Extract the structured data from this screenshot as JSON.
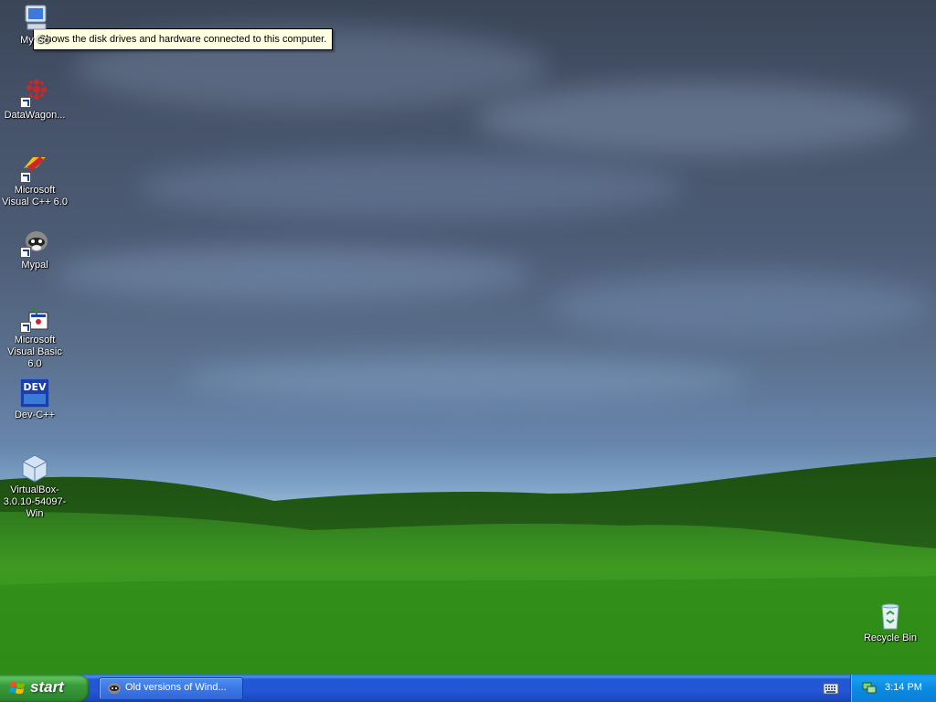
{
  "tooltip": {
    "text": "Shows the disk drives and hardware connected to this computer."
  },
  "desktop_icons": [
    {
      "label": "My Co",
      "icon": "my-computer-icon"
    },
    {
      "label": "DataWagon...",
      "icon": "datawagon-icon"
    },
    {
      "label": "Microsoft Visual C++ 6.0",
      "icon": "visual-cpp-icon"
    },
    {
      "label": "Mypal",
      "icon": "mypal-icon"
    },
    {
      "label": "Microsoft Visual Basic 6.0",
      "icon": "visual-basic-icon"
    },
    {
      "label": "Dev-C++",
      "icon": "dev-cpp-icon"
    },
    {
      "label": "VirtualBox-3.0.10-54097-Win",
      "icon": "virtualbox-icon"
    },
    {
      "label": "Recycle Bin",
      "icon": "recycle-bin-icon"
    }
  ],
  "devcpp_badge": "DEV",
  "taskbar": {
    "start_label": "start",
    "task_button_label": "Old versions of Wind...",
    "clock": "3:14 PM"
  },
  "colors": {
    "tooltip_bg": "#ffffe1",
    "taskbar_blue": "#2456d5",
    "start_green": "#3a9a3a",
    "tray_blue": "#0c8ae3"
  }
}
